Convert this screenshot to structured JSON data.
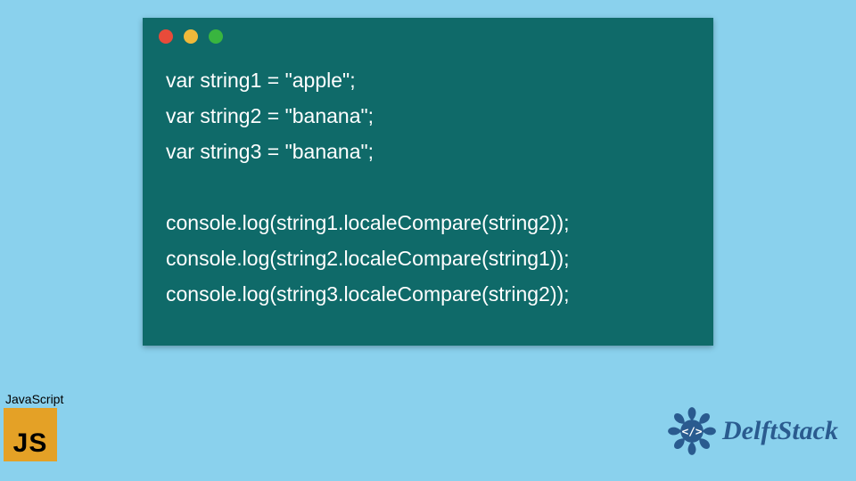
{
  "code": {
    "lines": [
      "var string1 = \"apple\";",
      "var string2 = \"banana\";",
      "var string3 = \"banana\";",
      "",
      "console.log(string1.localeCompare(string2));",
      "console.log(string2.localeCompare(string1));",
      "console.log(string3.localeCompare(string2));"
    ]
  },
  "badges": {
    "js_label": "JavaScript",
    "js_logo_text": "JS",
    "delft_text": "DelftStack"
  },
  "colors": {
    "page_bg": "#8ad1ed",
    "window_bg": "#0f6a69",
    "code_text": "#ffffff",
    "dot_red": "#e84b3a",
    "dot_yellow": "#f0b93a",
    "dot_green": "#39b53f",
    "js_logo_bg": "#e4a126",
    "delft_brand": "#2a5b8f"
  }
}
